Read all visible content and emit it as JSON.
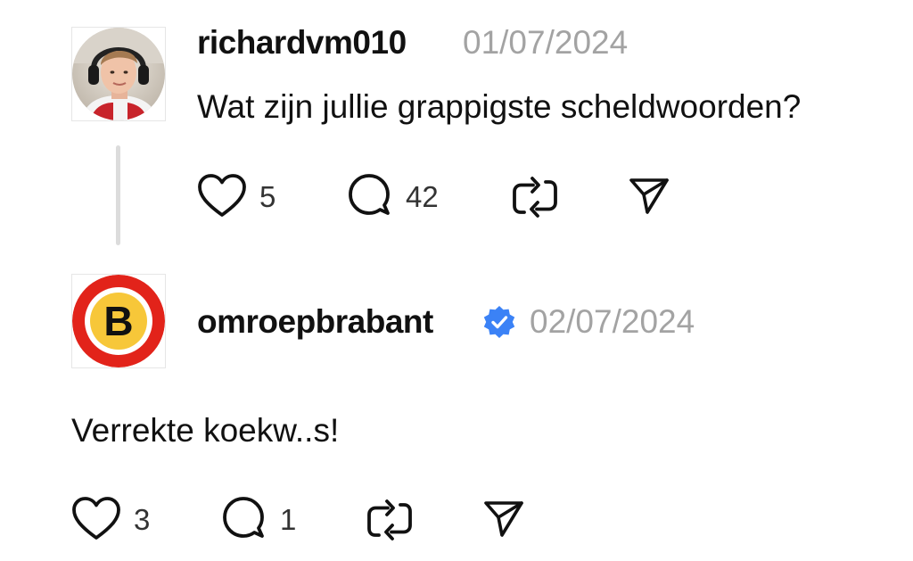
{
  "colors": {
    "text": "#111111",
    "muted": "#a3a3a3",
    "verified": "#3b82f6",
    "thread_line": "#dcdcdc",
    "brabant_red": "#e2231a",
    "brabant_yellow": "#f7c739"
  },
  "posts": [
    {
      "username": "richardvm010",
      "date": "01/07/2024",
      "text": "Wat zijn jullie grappigste scheldwoorden?",
      "verified": false,
      "actions": {
        "likes": "5",
        "comments": "42"
      },
      "icons": [
        "heart-icon",
        "comment-icon",
        "repost-icon",
        "send-icon"
      ]
    },
    {
      "username": "omroepbrabant",
      "date": "02/07/2024",
      "text": "Verrekte koekw..s!",
      "verified": true,
      "avatar_letter": "B",
      "actions": {
        "likes": "3",
        "comments": "1"
      },
      "icons": [
        "heart-icon",
        "comment-icon",
        "repost-icon",
        "send-icon"
      ]
    }
  ]
}
